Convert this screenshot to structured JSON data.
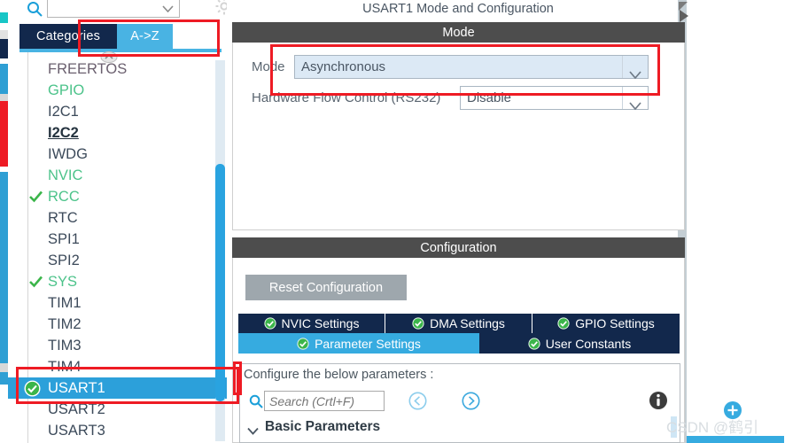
{
  "sidebar": {
    "search": {
      "placeholder": "",
      "value": "",
      "icon": "search-icon"
    },
    "gear_icon": "gear-icon",
    "tabs": [
      {
        "label": "Categories",
        "active": false
      },
      {
        "label": "A->Z",
        "active": true
      }
    ],
    "items": [
      {
        "label": "FREERTOS",
        "state": "normal"
      },
      {
        "label": "GPIO",
        "state": "green"
      },
      {
        "label": "I2C1",
        "state": "normal"
      },
      {
        "label": "I2C2",
        "state": "bold-underline"
      },
      {
        "label": "IWDG",
        "state": "normal"
      },
      {
        "label": "NVIC",
        "state": "green"
      },
      {
        "label": "RCC",
        "state": "green-check"
      },
      {
        "label": "RTC",
        "state": "normal"
      },
      {
        "label": "SPI1",
        "state": "normal"
      },
      {
        "label": "SPI2",
        "state": "normal"
      },
      {
        "label": "SYS",
        "state": "green-check"
      },
      {
        "label": "TIM1",
        "state": "normal"
      },
      {
        "label": "TIM2",
        "state": "normal"
      },
      {
        "label": "TIM3",
        "state": "normal"
      },
      {
        "label": "TIM4",
        "state": "normal"
      },
      {
        "label": "USART1",
        "state": "selected-check"
      },
      {
        "label": "USART2",
        "state": "normal"
      },
      {
        "label": "USART3",
        "state": "normal"
      }
    ]
  },
  "main": {
    "panel_title": "USART1 Mode and Configuration",
    "mode_section": {
      "header": "Mode",
      "rows": [
        {
          "label": "Mode",
          "value": "Asynchronous",
          "highlighted": true
        },
        {
          "label": "Hardware Flow Control (RS232)",
          "value": "Disable",
          "highlighted": false
        }
      ]
    },
    "config_section": {
      "header": "Configuration",
      "reset_button": "Reset Configuration",
      "tabs_row1": [
        {
          "label": "NVIC Settings",
          "active": false
        },
        {
          "label": "DMA Settings",
          "active": false
        },
        {
          "label": "GPIO Settings",
          "active": false
        }
      ],
      "tabs_row2": [
        {
          "label": "Parameter Settings",
          "active": true
        },
        {
          "label": "User Constants",
          "active": false
        }
      ],
      "param_caption": "Configure the below parameters :",
      "search_placeholder": "Search (Crtl+F)",
      "prev_icon": "circle-left-arrow-icon",
      "next_icon": "circle-right-arrow-icon",
      "info_icon": "info-icon",
      "group_label": "Basic Parameters"
    }
  },
  "watermark": {
    "text": "CSDN @鹤引"
  },
  "colors": {
    "accent_blue": "#36abe0",
    "navy": "#12284c",
    "green": "#3bb54a",
    "annotation_red": "#ee1b24",
    "header_grey": "#4d4d4d"
  }
}
